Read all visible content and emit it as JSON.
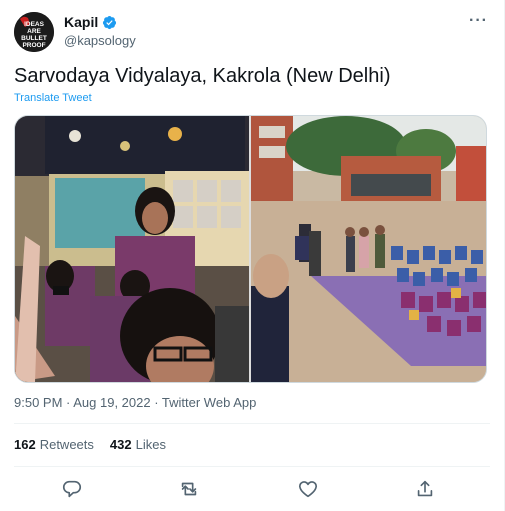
{
  "author": {
    "name": "Kapil",
    "handle": "@kapsology",
    "avatar_text": [
      "IDEAS",
      "ARE",
      "BULLET",
      "PROOF"
    ]
  },
  "tweet": {
    "text": "Sarvodaya Vidyalaya, Kakrola (New Delhi)",
    "translate_label": "Translate Tweet",
    "timestamp": "9:50 PM · Aug 19, 2022 · Twitter Web App"
  },
  "stats": {
    "retweets_count": "162",
    "retweets_label": "Retweets",
    "likes_count": "432",
    "likes_label": "Likes"
  },
  "icons": {
    "more": "more-icon",
    "verified": "verified-badge-icon",
    "reply": "reply-icon",
    "retweet": "retweet-icon",
    "like": "like-icon",
    "share": "share-icon"
  },
  "colors": {
    "accent": "#1d9bf0",
    "secondary_text": "#536471",
    "primary_text": "#0f1419"
  }
}
